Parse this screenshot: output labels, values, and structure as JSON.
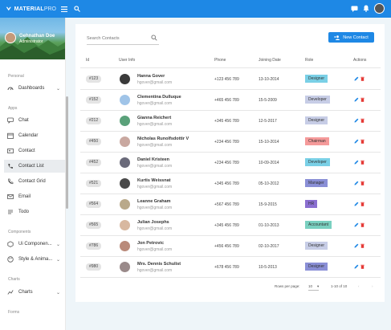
{
  "topbar": {
    "brand_bold": "MATERIAL",
    "brand_light": "PRO",
    "accent": "#1e88e5"
  },
  "sidebar": {
    "user_name": "Gehnathan Doe",
    "user_role": "Administrator",
    "sections": [
      {
        "label": "Personal"
      },
      {
        "label": "Apps"
      },
      {
        "label": "Components"
      },
      {
        "label": "Charts"
      },
      {
        "label": "Forms"
      }
    ],
    "items": [
      {
        "label": "Dashboards",
        "icon": "gauge-icon",
        "chevron": "⌄"
      },
      {
        "label": "Chat",
        "icon": "chat-icon"
      },
      {
        "label": "Calendar",
        "icon": "calendar-icon"
      },
      {
        "label": "Contact",
        "icon": "contact-icon"
      },
      {
        "label": "Contact List",
        "icon": "phone-icon"
      },
      {
        "label": "Contact Grid",
        "icon": "grid-icon"
      },
      {
        "label": "Email",
        "icon": "mail-icon"
      },
      {
        "label": "Todo",
        "icon": "todo-icon"
      },
      {
        "label": "Ui Componen...",
        "icon": "cube-icon",
        "chevron": "⌄"
      },
      {
        "label": "Style & Anima...",
        "icon": "palette-icon",
        "chevron": "⌄"
      },
      {
        "label": "Charts",
        "icon": "chart-icon",
        "chevron": "⌄"
      }
    ]
  },
  "main": {
    "search_placeholder": "Search Contacts",
    "new_contact_label": "New Contact",
    "columns": [
      "Id",
      "User Info",
      "Phone",
      "Joining Date",
      "Role",
      "Actions"
    ],
    "rows": [
      {
        "id": "#123",
        "name": "Hanna Gover",
        "email": "hgover@gmail.com",
        "phone": "+123 456 789",
        "date": "13-10-2014",
        "role": "Designer",
        "role_color": "#7ad0e6",
        "avatar_color": "#3a3a3a"
      },
      {
        "id": "#152",
        "name": "Clementina Dulluque",
        "email": "hgover@gmail.com",
        "phone": "+465 456 789",
        "date": "15-5-2009",
        "role": "Developer",
        "role_color": "#c7cde6",
        "avatar_color": "#a0c4e8"
      },
      {
        "id": "#212",
        "name": "Gianna Reichert",
        "email": "hgover@gmail.com",
        "phone": "+345 456 789",
        "date": "12-5-2017",
        "role": "Designer",
        "role_color": "#c7cde6",
        "avatar_color": "#5aa17a"
      },
      {
        "id": "#450",
        "name": "Nicholas Runolfsdottir V",
        "email": "hgover@gmail.com",
        "phone": "+234 456 789",
        "date": "15-10-2014",
        "role": "Chairman",
        "role_color": "#f59a9a",
        "avatar_color": "#c9a8a0"
      },
      {
        "id": "#452",
        "name": "Daniel Kristeen",
        "email": "hgover@gmail.com",
        "phone": "+234 456 789",
        "date": "10-09-2014",
        "role": "Developer",
        "role_color": "#7ad0e6",
        "avatar_color": "#6a6a7a"
      },
      {
        "id": "#521",
        "name": "Kurtis Weissnat",
        "email": "hgover@gmail.com",
        "phone": "+345 456 789",
        "date": "05-10-2012",
        "role": "Manager",
        "role_color": "#8a8fd6",
        "avatar_color": "#4a4a4a"
      },
      {
        "id": "#564",
        "name": "Leanne Graham",
        "email": "hgover@gmail.com",
        "phone": "+567 456 789",
        "date": "15-9-2015",
        "role": "HR",
        "role_color": "#8a6fd0",
        "avatar_color": "#b9a98a"
      },
      {
        "id": "#565",
        "name": "Julian Josephs",
        "email": "hgover@gmail.com",
        "phone": "+345 456 789",
        "date": "01-10-2013",
        "role": "Accountant",
        "role_color": "#7ad0c0",
        "avatar_color": "#d8b8a0"
      },
      {
        "id": "#786",
        "name": "Jon Petrovic",
        "email": "hgover@gmail.com",
        "phone": "+456 456 789",
        "date": "02-10-2017",
        "role": "Designer",
        "role_color": "#c7cde6",
        "avatar_color": "#b98a7a"
      },
      {
        "id": "#980",
        "name": "Mrs. Dennis Schulist",
        "email": "hgover@gmail.com",
        "phone": "+678 456 789",
        "date": "10-5-2013",
        "role": "Designer",
        "role_color": "#8a8fd6",
        "avatar_color": "#9a8a8a"
      }
    ],
    "rows_per_page_label": "Rows per page:",
    "rows_per_page_value": "10",
    "range_label": "1-10 of 10"
  }
}
